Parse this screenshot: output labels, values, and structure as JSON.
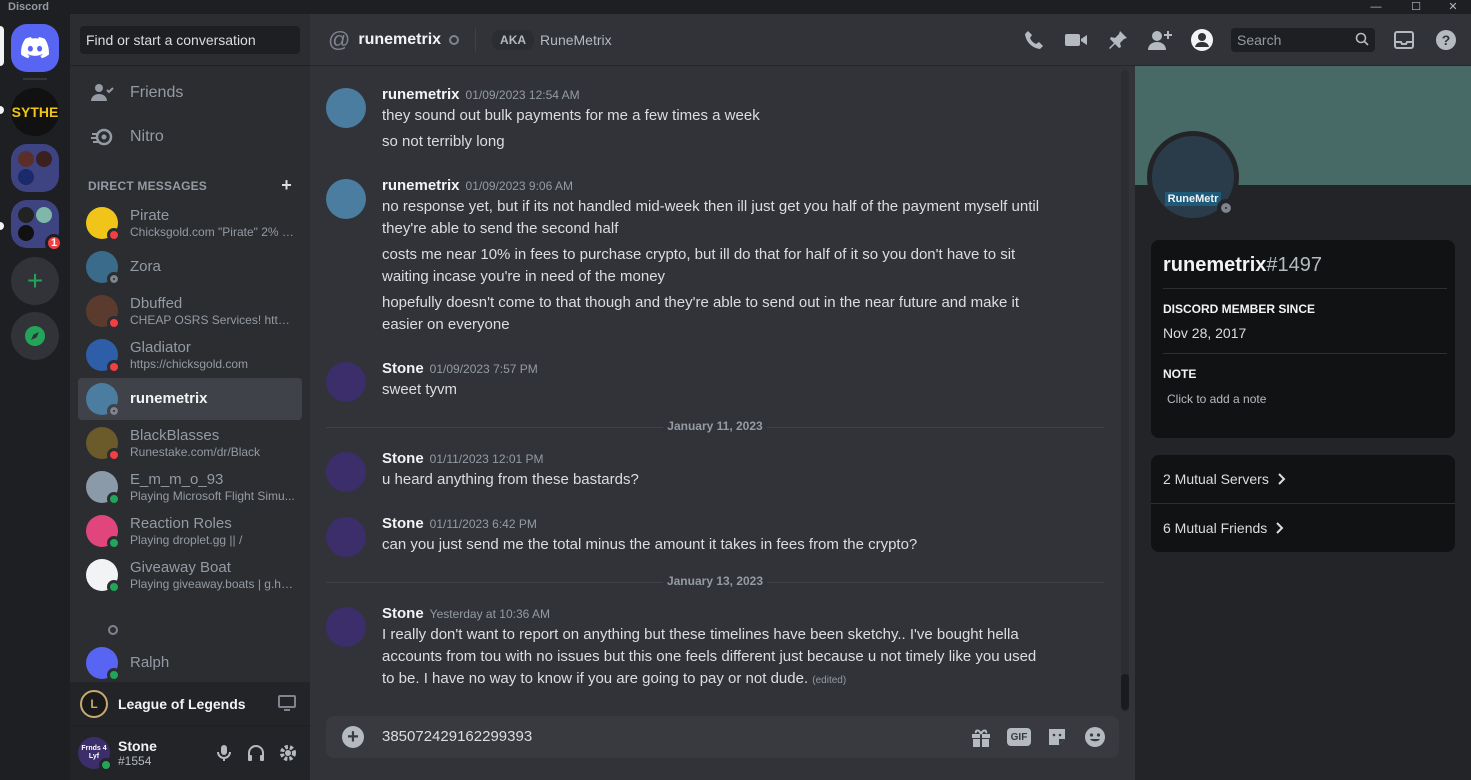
{
  "window": {
    "app_name": "Discord",
    "minimize": "—",
    "maximize": "☐",
    "close": "✕"
  },
  "servers": {
    "sythe_label": "SYTHE",
    "folder_badge": "1",
    "add_symbol": "+"
  },
  "dm_column": {
    "search_placeholder": "Find or start a conversation",
    "nav": [
      {
        "label": "Friends"
      },
      {
        "label": "Nitro"
      }
    ],
    "section_title": "Direct Messages",
    "add_symbol": "+",
    "dms": [
      {
        "name": "Pirate",
        "sub": "Chicksgold.com \"Pirate\" 2% of...",
        "status": "dnd"
      },
      {
        "name": "Zora",
        "sub": "",
        "status": "offline"
      },
      {
        "name": "Dbuffed",
        "sub": "CHEAP OSRS Services! https:...",
        "status": "dnd"
      },
      {
        "name": "Gladiator",
        "sub": "https://chicksgold.com",
        "status": "dnd"
      },
      {
        "name": "runemetrix",
        "sub": "",
        "status": "offline"
      },
      {
        "name": "BlackBlasses",
        "sub": "Runestake.com/dr/Black",
        "status": "dnd"
      },
      {
        "name": "E_m_m_o_93",
        "sub": "Playing Microsoft Flight Simu...",
        "status": "online"
      },
      {
        "name": "Reaction Roles",
        "sub": "Playing droplet.gg || /",
        "status": "online"
      },
      {
        "name": "Giveaway Boat",
        "sub": "Playing giveaway.boats | g.help",
        "status": "online"
      },
      {
        "name": "Ralph",
        "sub": "",
        "status": "online"
      }
    ],
    "activity": {
      "name": "League of Legends"
    },
    "user": {
      "name": "Stone",
      "tag": "#1554",
      "avatar_text": "Frnds 4 Lyf"
    }
  },
  "chat": {
    "header": {
      "name": "runemetrix",
      "aka_label": "AKA",
      "aka_name": "RuneMetrix",
      "search_placeholder": "Search"
    },
    "messages": [
      {
        "author": "runemetrix",
        "time": "01/09/2023 12:54 AM",
        "lines": [
          "they sound out bulk payments for me a few times a week",
          "so not terribly long"
        ]
      },
      {
        "author": "runemetrix",
        "time": "01/09/2023 9:06 AM",
        "lines": [
          "no response yet, but if its not handled mid-week then ill just get you half of the payment myself until",
          "they're able to send the second half",
          "costs me near 10% in fees to purchase crypto, but ill do that for half of it so you don't have to sit",
          "waiting incase you're in need of the money",
          "hopefully doesn't come to that though and they're able to send out in the near future and make it",
          "easier on everyone"
        ]
      },
      {
        "author": "Stone",
        "time": "01/09/2023 7:57 PM",
        "lines": [
          "sweet tyvm"
        ]
      },
      {
        "author": "Stone",
        "time": "01/11/2023 12:01 PM",
        "lines": [
          "u heard anything from these bastards?"
        ]
      },
      {
        "author": "Stone",
        "time": "01/11/2023 6:42 PM",
        "lines": [
          "can you just send me the total minus the amount it takes in fees from the crypto?"
        ]
      },
      {
        "author": "Stone",
        "time": "Yesterday at 10:36 AM",
        "lines": [
          "I really don't want to report on anything but these timelines have been sketchy.. I've bought hella",
          "accounts from tou with no issues but this one feels different just because u not timely like you used",
          "to be.  I have no way to know if you are going to pay or not dude."
        ],
        "edited": "(edited)"
      }
    ],
    "dividers": [
      "January 11, 2023",
      "January 13, 2023"
    ],
    "composer": {
      "value": "385072429162299393",
      "gif_label": "GIF"
    }
  },
  "profile": {
    "username": "runemetrix",
    "discriminator": "#1497",
    "member_since_label": "Discord Member Since",
    "member_since": "Nov 28, 2017",
    "note_label": "Note",
    "note_placeholder": "Click to add a note",
    "mutual_servers": "2 Mutual Servers",
    "mutual_friends": "6 Mutual Friends",
    "avatar_text": "RuneMetr"
  },
  "colors": {
    "blurple": "#5865f2",
    "dnd": "#f23f43",
    "online": "#23a559",
    "offline": "#80848e",
    "banner": "#476a66"
  }
}
